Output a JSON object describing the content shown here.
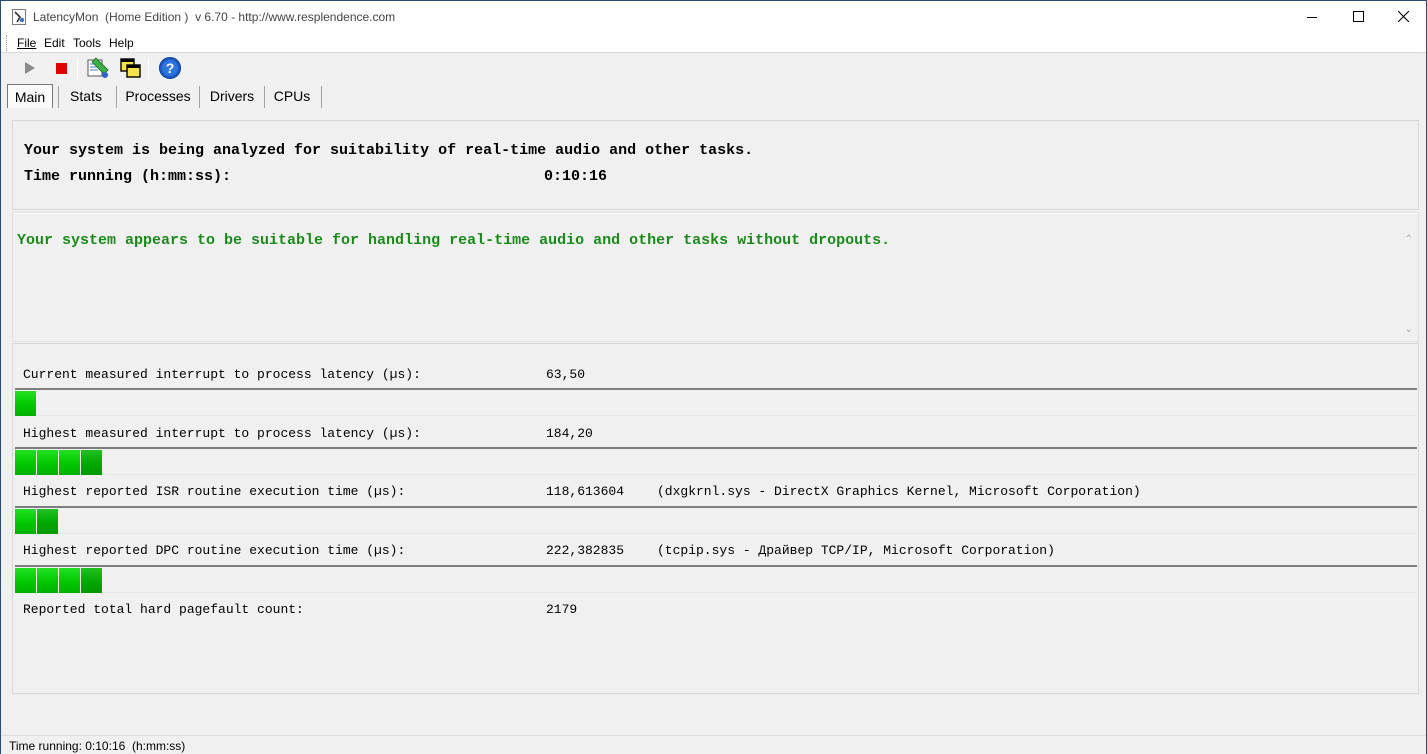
{
  "window": {
    "title": "LatencyMon  (Home Edition )  v 6.70 - http://www.resplendence.com",
    "app_icon": "latencymon-icon",
    "controls": {
      "minimize": "minimize-icon",
      "maximize": "maximize-icon",
      "close": "close-icon"
    }
  },
  "menu": {
    "items": [
      {
        "label": "File",
        "underline": "F"
      },
      {
        "label": "Edit",
        "underline": "E"
      },
      {
        "label": "Tools",
        "underline": "T"
      },
      {
        "label": "Help",
        "underline": "H"
      }
    ]
  },
  "toolbar": {
    "buttons": [
      {
        "name": "start-button",
        "icon": "play-icon",
        "color": "#8a8a8a"
      },
      {
        "name": "stop-button",
        "icon": "stop-icon",
        "color": "#e00000"
      },
      {
        "name": "report-button",
        "icon": "report-icon"
      },
      {
        "name": "windows-button",
        "icon": "windows-icon"
      },
      {
        "name": "help-button",
        "icon": "help-icon",
        "color": "#1c5bc7"
      }
    ]
  },
  "tabs": [
    {
      "label": "Main",
      "active": true
    },
    {
      "label": "Stats",
      "active": false
    },
    {
      "label": "Processes",
      "active": false
    },
    {
      "label": "Drivers",
      "active": false
    },
    {
      "label": "CPUs",
      "active": false
    }
  ],
  "main": {
    "analysis_text": "Your system is being analyzed for suitability of real-time audio and other tasks.",
    "time_label": "Time running (h:mm:ss):",
    "time_value": "0:10:16",
    "verdict": "Your system appears to be suitable for handling real-time audio and other tasks without dropouts.",
    "verdict_color": "#1a8a1a",
    "metrics": [
      {
        "label": "Current measured interrupt to process latency (µs):",
        "value": "63,50",
        "detail": "",
        "bar_segments": 1
      },
      {
        "label": "Highest measured interrupt to process latency (µs):",
        "value": "184,20",
        "detail": "",
        "bar_segments": 4
      },
      {
        "label": "Highest reported ISR routine execution time (µs):",
        "value": "118,613604",
        "detail": "(dxgkrnl.sys - DirectX Graphics Kernel, Microsoft Corporation)",
        "bar_segments": 2
      },
      {
        "label": "Highest reported DPC routine execution time (µs):",
        "value": "222,382835",
        "detail": "(tcpip.sys - Драйвер TCP/IP, Microsoft Corporation)",
        "bar_segments": 4
      }
    ],
    "pagefault_label": "Reported total hard pagefault count:",
    "pagefault_value": "2179",
    "bar_color": "#00c800"
  },
  "statusbar": {
    "text": "Time running: 0:10:16  (h:mm:ss)"
  }
}
